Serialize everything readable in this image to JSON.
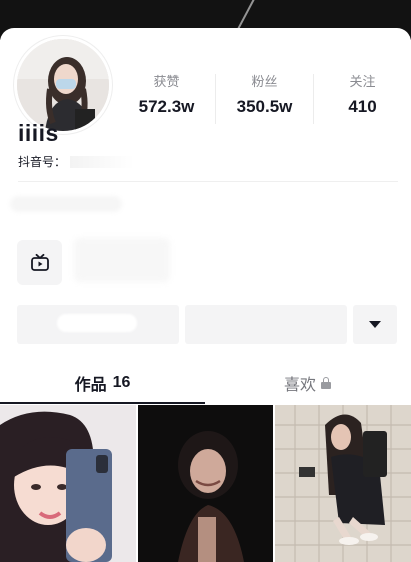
{
  "profile": {
    "nickname": "iiiis",
    "id_label": "抖音号："
  },
  "stats": [
    {
      "label": "获赞",
      "value": "572.3w"
    },
    {
      "label": "粉丝",
      "value": "350.5w"
    },
    {
      "label": "关注",
      "value": "410"
    }
  ],
  "tabs": [
    {
      "label": "作品",
      "count": "16",
      "active": true
    },
    {
      "label": "喜欢",
      "locked": true,
      "active": false
    }
  ],
  "icons": {
    "tv": "tv-icon",
    "dropdown": "caret-down-icon",
    "lock": "lock-icon"
  },
  "colors": {
    "text_primary": "#161823",
    "text_secondary": "#8a8b91",
    "button_bg": "#f4f4f5"
  }
}
